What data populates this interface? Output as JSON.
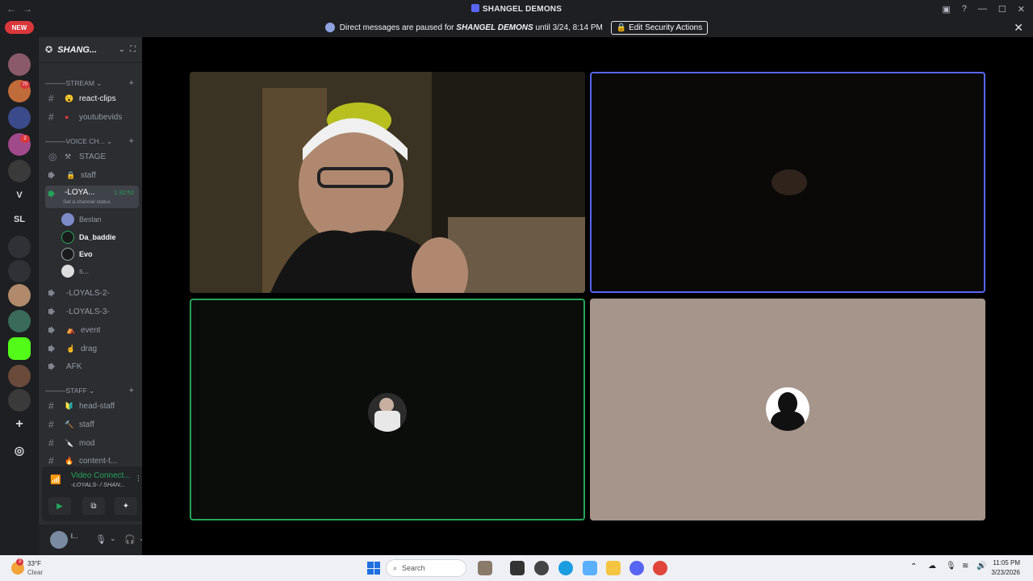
{
  "window": {
    "title": "SHANGEL DEMONS",
    "nav_back": "←",
    "nav_forward": "→"
  },
  "banner": {
    "text_before": "Direct messages are paused for",
    "server": "SHANGEL DEMONS",
    "text_after": "until 3/24, 8:14 PM",
    "button": "Edit Security Actions"
  },
  "guild_rail": {
    "new_badge": "NEW",
    "badges": [
      "70",
      "2"
    ],
    "text_guilds": [
      "V",
      "SL"
    ]
  },
  "server": {
    "name": "SHANG..."
  },
  "categories": {
    "stream": "STREAM",
    "voice": "VOICE CH...",
    "staff": "STAFF"
  },
  "channels": {
    "react_clips": "react-clips",
    "youtubevids": "youtubevids",
    "stage": "STAGE",
    "staff_voice": "staff",
    "loyals": "-LOYA...",
    "loyals_timer": "1:32:52",
    "loyals_status": "Set a channel status",
    "loyals2": "-LOYALS-2-",
    "loyals3": "-LOYALS-3-",
    "event": "event",
    "drag": "drag",
    "afk": "AFK",
    "head_staff": "head-staff",
    "staff_text": "staff",
    "mod": "mod",
    "content": "content-t..."
  },
  "voice_users": [
    "Beslan",
    "Da_baddie",
    "Evo",
    "s..."
  ],
  "voice_connection": {
    "title": "Video Connect...",
    "subtitle": "-LOYALS- / SHAN..."
  },
  "user_panel": {
    "name": "l..."
  },
  "taskbar": {
    "weather_temp": "33°F",
    "weather_desc": "Clear",
    "search": "Search",
    "time": "11:05 PM",
    "date": "3/23/2026"
  },
  "colors": {
    "blurple": "#5865f2",
    "green": "#23a55a",
    "red": "#da373c"
  }
}
